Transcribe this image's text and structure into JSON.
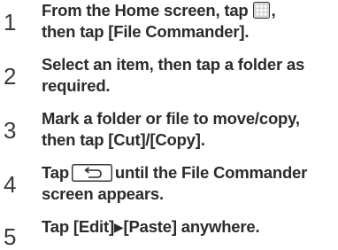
{
  "steps": [
    {
      "number": "1",
      "line1_a": "From the Home screen, tap",
      "line1_b": ",",
      "line2": "then tap [File Commander].",
      "icon": "apps-grid-icon"
    },
    {
      "number": "2",
      "line1": "Select an item, then tap a folder as",
      "line2": "required."
    },
    {
      "number": "3",
      "line1": "Mark a folder or file to move/copy,",
      "line2": "then tap [Cut]/[Copy]."
    },
    {
      "number": "4",
      "line1_a": "Tap",
      "line1_b": "until the File Commander",
      "line2": "screen appears.",
      "icon": "back-key-icon"
    },
    {
      "number": "5",
      "line1_a": "Tap [Edit]",
      "arrow": "▶",
      "line1_b": "[Paste] anywhere."
    }
  ],
  "colors": {
    "text": "#2b2b2b",
    "icon_fill": "#bfbfbf",
    "icon_border": "#3a3a3a"
  }
}
